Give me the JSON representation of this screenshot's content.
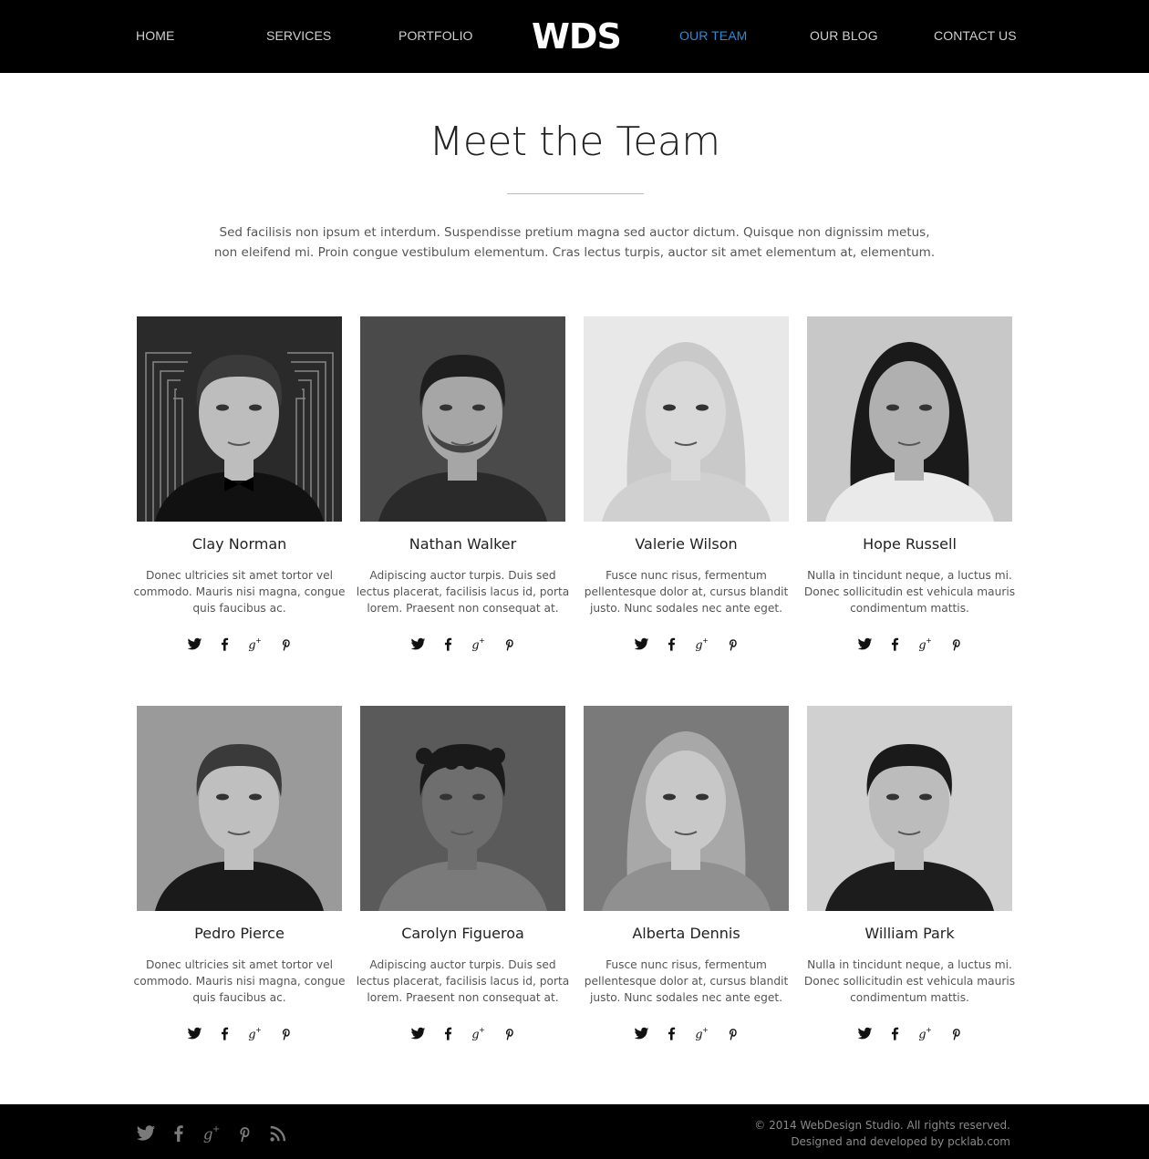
{
  "nav": {
    "items": [
      "HOME",
      "SERVICES",
      "PORTFOLIO",
      "OUR TEAM",
      "OUR BLOG",
      "CONTACT US"
    ],
    "active": "OUR TEAM",
    "logo": "WDS",
    "active_color": "#2b8bd6"
  },
  "main": {
    "title": "Meet the Team",
    "intro_line1": "Sed facilisis non ipsum et interdum. Suspendisse pretium magna sed auctor dictum. Quisque non dignissim metus,",
    "intro_line2": "non eleifend mi. Proin congue vestibulum elementum. Cras lectus turpis, auctor sit amet elementum at, elementum."
  },
  "team": [
    {
      "name": "Clay Norman",
      "bio": "Donec ultricies sit amet tortor vel commodo. Mauris nisi magna, congue quis faucibus ac.",
      "gender": "male"
    },
    {
      "name": "Nathan Walker",
      "bio": "Adipiscing auctor turpis. Duis sed lectus placerat, facilisis lacus id, porta lorem. Praesent non consequat at.",
      "gender": "male"
    },
    {
      "name": "Valerie Wilson",
      "bio": "Fusce nunc risus, fermentum pellentesque dolor at, cursus blandit justo. Nunc sodales nec ante eget.",
      "gender": "female"
    },
    {
      "name": "Hope Russell",
      "bio": "Nulla in tincidunt neque, a luctus mi. Donec sollicitudin est vehicula mauris condimentum mattis.",
      "gender": "female"
    },
    {
      "name": "Pedro Pierce",
      "bio": "Donec ultricies sit amet tortor vel commodo. Mauris nisi magna, congue quis faucibus ac.",
      "gender": "male"
    },
    {
      "name": "Carolyn Figueroa",
      "bio": "Adipiscing auctor turpis. Duis sed lectus placerat, facilisis lacus id, porta lorem. Praesent non consequat at.",
      "gender": "female"
    },
    {
      "name": "Alberta Dennis",
      "bio": "Fusce nunc risus, fermentum pellentesque dolor at, cursus blandit justo. Nunc sodales nec ante eget.",
      "gender": "female"
    },
    {
      "name": "William Park",
      "bio": "Nulla in tincidunt neque, a luctus mi. Donec sollicitudin est vehicula mauris condimentum mattis.",
      "gender": "male"
    }
  ],
  "card_social_icons": [
    "twitter-icon",
    "facebook-icon",
    "google-plus-icon",
    "pinterest-icon"
  ],
  "footer": {
    "social_icons": [
      "twitter-icon",
      "facebook-icon",
      "google-plus-icon",
      "pinterest-icon",
      "rss-icon"
    ],
    "copyright_line1": "© 2014 WebDesign Studio. All rights reserved.",
    "copyright_line2": "Designed and developed by pcklab.com"
  }
}
